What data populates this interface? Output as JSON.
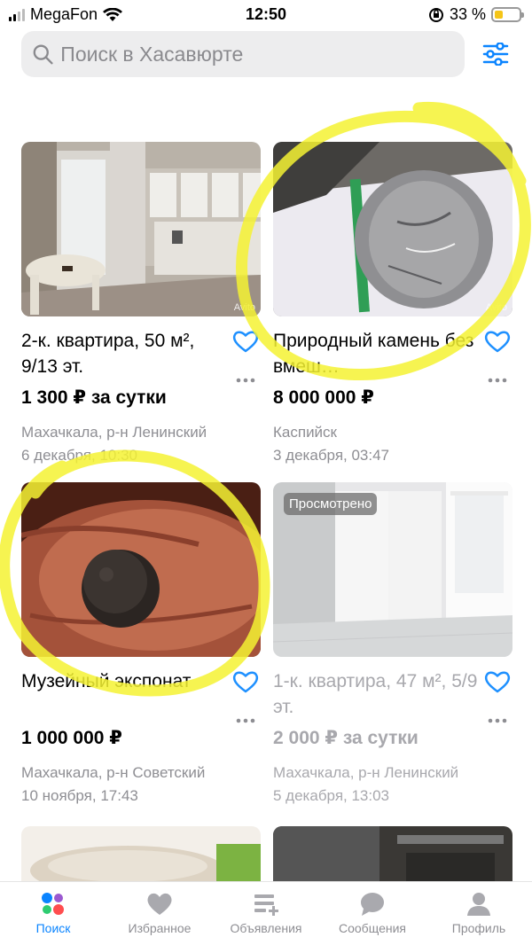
{
  "status_bar": {
    "carrier": "MegaFon",
    "time": "12:50",
    "battery": "33 %",
    "battery_level": 0.33
  },
  "search": {
    "placeholder": "Поиск в Хасавюрте"
  },
  "listings": [
    {
      "title": "2-к. квартира, 50 м², 9/13 эт.",
      "price": "1 300 ₽ за сутки",
      "location": "Махачкала, р-н Ленинский",
      "date": "6 декабря, 10:30",
      "watermark": "Avito"
    },
    {
      "title": "Природный камень без вмеш…",
      "price": "8 000 000 ₽",
      "location": "Каспийск",
      "date": "3 декабря, 03:47",
      "watermark": "Avito"
    },
    {
      "title": "Музейный экспонат",
      "price": "1 000 000 ₽",
      "location": "Махачкала, р-н Советский",
      "date": "10 ноября, 17:43"
    },
    {
      "title": "1-к. квартира, 47 м², 5/9 эт.",
      "price": "2 000 ₽ за сутки",
      "location": "Махачкала, р-н Ленинский",
      "date": "5 декабря, 13:03",
      "badge": "Просмотрено"
    }
  ],
  "tabs": [
    {
      "label": "Поиск",
      "icon": "search-dots-icon",
      "active": true
    },
    {
      "label": "Избранное",
      "icon": "heart-icon"
    },
    {
      "label": "Объявления",
      "icon": "add-listing-icon"
    },
    {
      "label": "Сообщения",
      "icon": "chat-bubble-icon"
    },
    {
      "label": "Профиль",
      "icon": "profile-icon"
    }
  ],
  "colors": {
    "accent": "#0a84ff",
    "heart": "#1e90ff",
    "highlight": "#f5f232",
    "secondary_text": "#8e8e93"
  }
}
